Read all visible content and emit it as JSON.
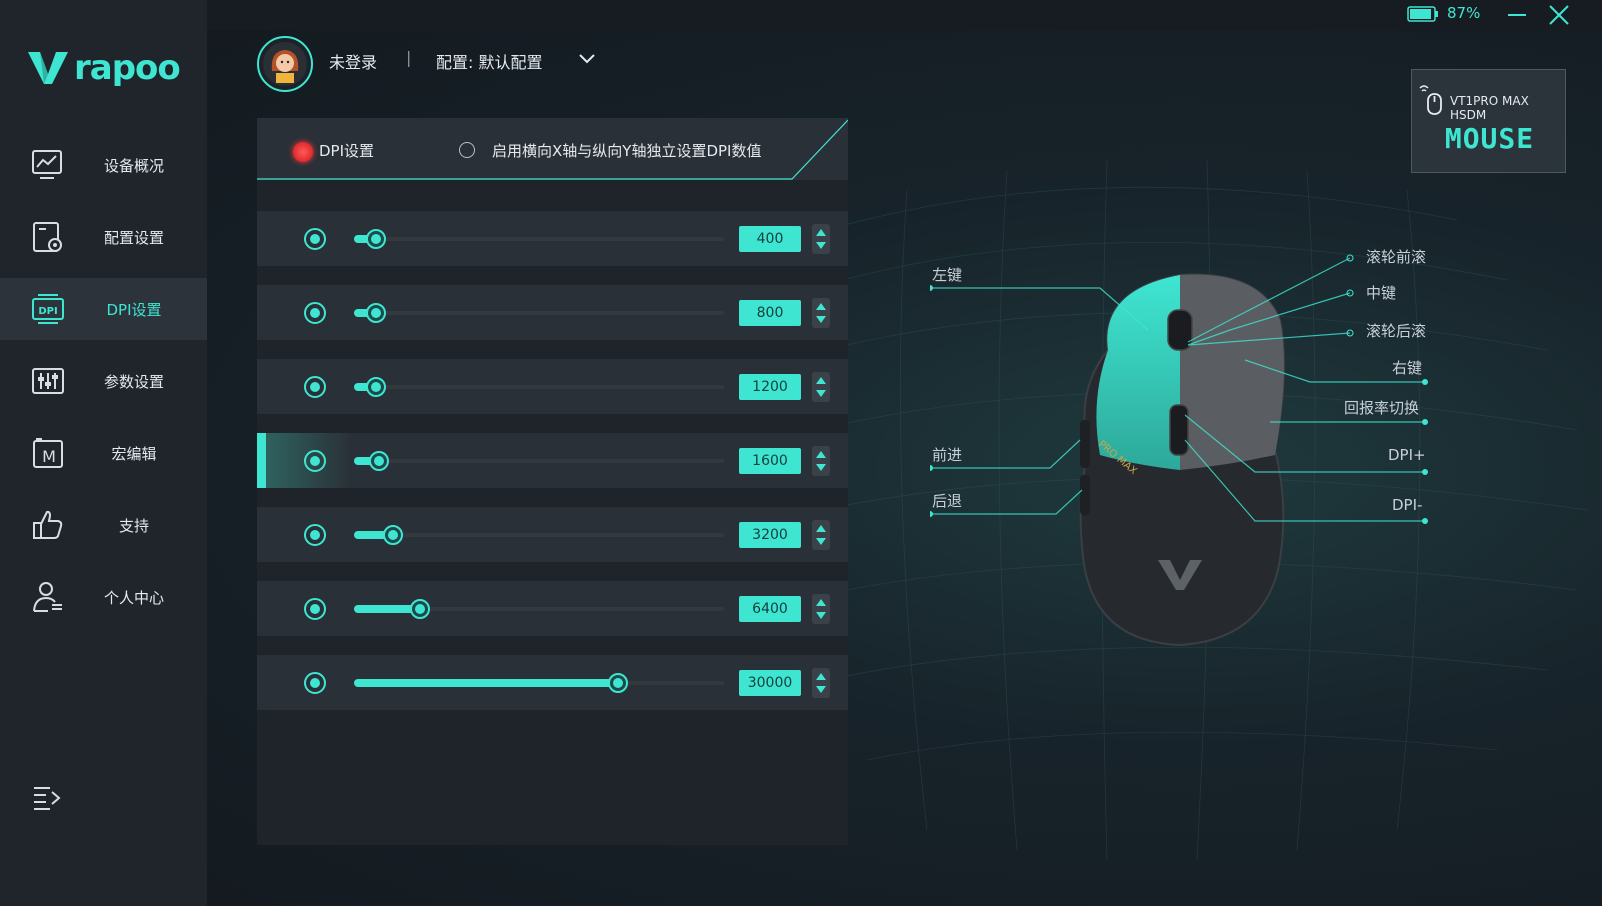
{
  "window": {
    "battery_percent": "87%"
  },
  "brand": {
    "name": "rapoo"
  },
  "nav": {
    "items": [
      {
        "label": "设备概况",
        "icon": "monitor-chart-icon",
        "active": false
      },
      {
        "label": "配置设置",
        "icon": "config-settings-icon",
        "active": false
      },
      {
        "label": "DPI设置",
        "icon": "dpi-icon",
        "active": true
      },
      {
        "label": "参数设置",
        "icon": "sliders-icon",
        "active": false
      },
      {
        "label": "宏编辑",
        "icon": "macro-m-icon",
        "active": false
      },
      {
        "label": "支持",
        "icon": "thumbs-up-icon",
        "active": false
      },
      {
        "label": "个人中心",
        "icon": "user-center-icon",
        "active": false
      }
    ]
  },
  "header": {
    "login_status": "未登录",
    "separator": "|",
    "profile_label": "配置: 默认配置"
  },
  "dpi_panel": {
    "mode_label": "DPI设置",
    "xy_option_label": "启用横向X轴与纵向Y轴独立设置DPI数值",
    "max_dpi": 30000,
    "rows": [
      {
        "value": "400",
        "level": 400,
        "active": false
      },
      {
        "value": "800",
        "level": 800,
        "active": false
      },
      {
        "value": "1200",
        "level": 1200,
        "active": false
      },
      {
        "value": "1600",
        "level": 1600,
        "active": true
      },
      {
        "value": "3200",
        "level": 3200,
        "active": false
      },
      {
        "value": "6400",
        "level": 6400,
        "active": false
      },
      {
        "value": "30000",
        "level": 30000,
        "active": false
      }
    ]
  },
  "device": {
    "name": "VT1PRO MAX HSDM",
    "type": "MOUSE",
    "model_badge": "PRO MAX"
  },
  "mouse_callouts": {
    "left_button": "左键",
    "forward": "前进",
    "back": "后退",
    "scroll_up": "滚轮前滚",
    "middle": "中键",
    "scroll_down": "滚轮后滚",
    "right_button": "右键",
    "polling_rate": "回报率切换",
    "dpi_plus": "DPI+",
    "dpi_minus": "DPI-"
  },
  "colors": {
    "accent": "#3ee6d2",
    "active_dot": "#e02a2a"
  }
}
